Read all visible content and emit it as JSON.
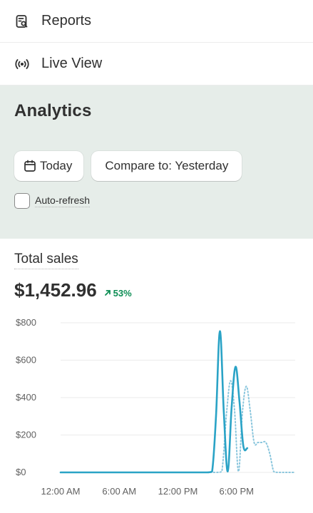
{
  "nav": {
    "items": [
      {
        "label": "Reports",
        "icon": "reports-icon"
      },
      {
        "label": "Live View",
        "icon": "live-view-icon"
      }
    ]
  },
  "analytics": {
    "title": "Analytics",
    "date_button": {
      "label": "Today",
      "icon": "calendar-icon"
    },
    "compare_button": {
      "label": "Compare to: Yesterday"
    },
    "auto_refresh": {
      "label": "Auto-refresh",
      "checked": false
    }
  },
  "sales": {
    "label": "Total sales",
    "value": "$1,452.96",
    "change": "53%",
    "change_direction": "up",
    "change_color": "#0c8d54"
  },
  "chart_data": {
    "type": "line",
    "x_labels": [
      "12:00 AM",
      "6:00 AM",
      "12:00 PM",
      "6:00 PM"
    ],
    "y_ticks": [
      "$0",
      "$200",
      "$400",
      "$600",
      "$800"
    ],
    "ylim": [
      0,
      800
    ],
    "xlim": [
      0,
      24
    ],
    "grid": true,
    "series": [
      {
        "style": "solid",
        "color": "#2aa3c6",
        "x": [
          0,
          1,
          2,
          3,
          4,
          5,
          6,
          7,
          8,
          9,
          10,
          11,
          12,
          13,
          14,
          15,
          15.5,
          15.9,
          16.3,
          16.7,
          17.1,
          17.5,
          17.9,
          18.3,
          18.7,
          19.1
        ],
        "y": [
          0,
          0,
          0,
          0,
          0,
          0,
          0,
          0,
          0,
          0,
          0,
          0,
          0,
          0,
          0,
          0,
          5,
          300,
          755,
          320,
          5,
          350,
          565,
          380,
          140,
          130
        ]
      },
      {
        "style": "dotted",
        "color": "#8ac6dd",
        "x": [
          15,
          16,
          16.5,
          17,
          17.4,
          17.8,
          18.2,
          18.6,
          19,
          19.4,
          19.8,
          20.2,
          20.6,
          21,
          21.4,
          21.8,
          22.2,
          22.6,
          23,
          23.5,
          24
        ],
        "y": [
          0,
          0,
          5,
          330,
          490,
          330,
          5,
          320,
          460,
          330,
          160,
          160,
          160,
          160,
          100,
          5,
          0,
          0,
          0,
          0,
          0
        ]
      }
    ]
  }
}
